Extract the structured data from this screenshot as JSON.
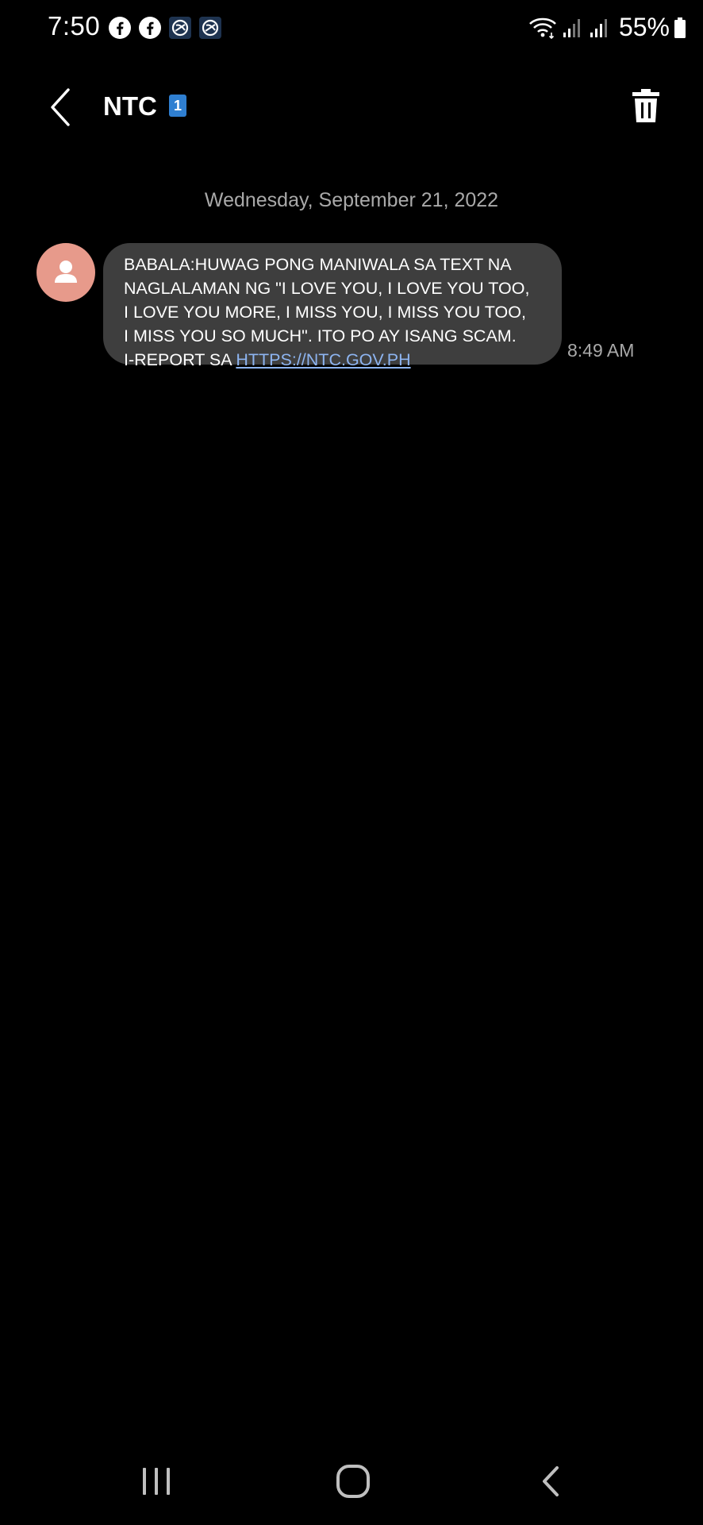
{
  "status_bar": {
    "time": "7:50",
    "battery": "55%",
    "left_icons": [
      "facebook-icon",
      "facebook-icon",
      "app-notification-icon",
      "app-notification-icon"
    ],
    "right_icons": [
      "wifi-icon",
      "signal-icon",
      "signal-icon",
      "battery-icon"
    ]
  },
  "header": {
    "contact_name": "NTC",
    "sim_badge": "1",
    "back_icon": "chevron-left-icon",
    "delete_icon": "trash-icon"
  },
  "conversation": {
    "date": "Wednesday, September 21, 2022",
    "messages": [
      {
        "text": "BABALA:HUWAG PONG MANIWALA SA TEXT NA\nNAGLALAMAN NG \"I LOVE YOU, I LOVE YOU TOO,\nI LOVE YOU MORE, I  MISS YOU, I MISS YOU TOO,\nI MISS YOU SO MUCH\". ITO PO AY ISANG SCAM.\nI-REPORT SA ",
        "link": "HTTPS://NTC.GOV.PH",
        "time": "8:49 AM"
      }
    ]
  },
  "nav_bar": {
    "buttons": [
      "recents-icon",
      "home-icon",
      "back-icon"
    ]
  },
  "colors": {
    "background": "#000000",
    "bubble": "#3e3e3e",
    "avatar": "#e79a8b",
    "link": "#8db4f0",
    "secondary_text": "#a9a9a9",
    "sim_badge": "#2f7fd1"
  }
}
